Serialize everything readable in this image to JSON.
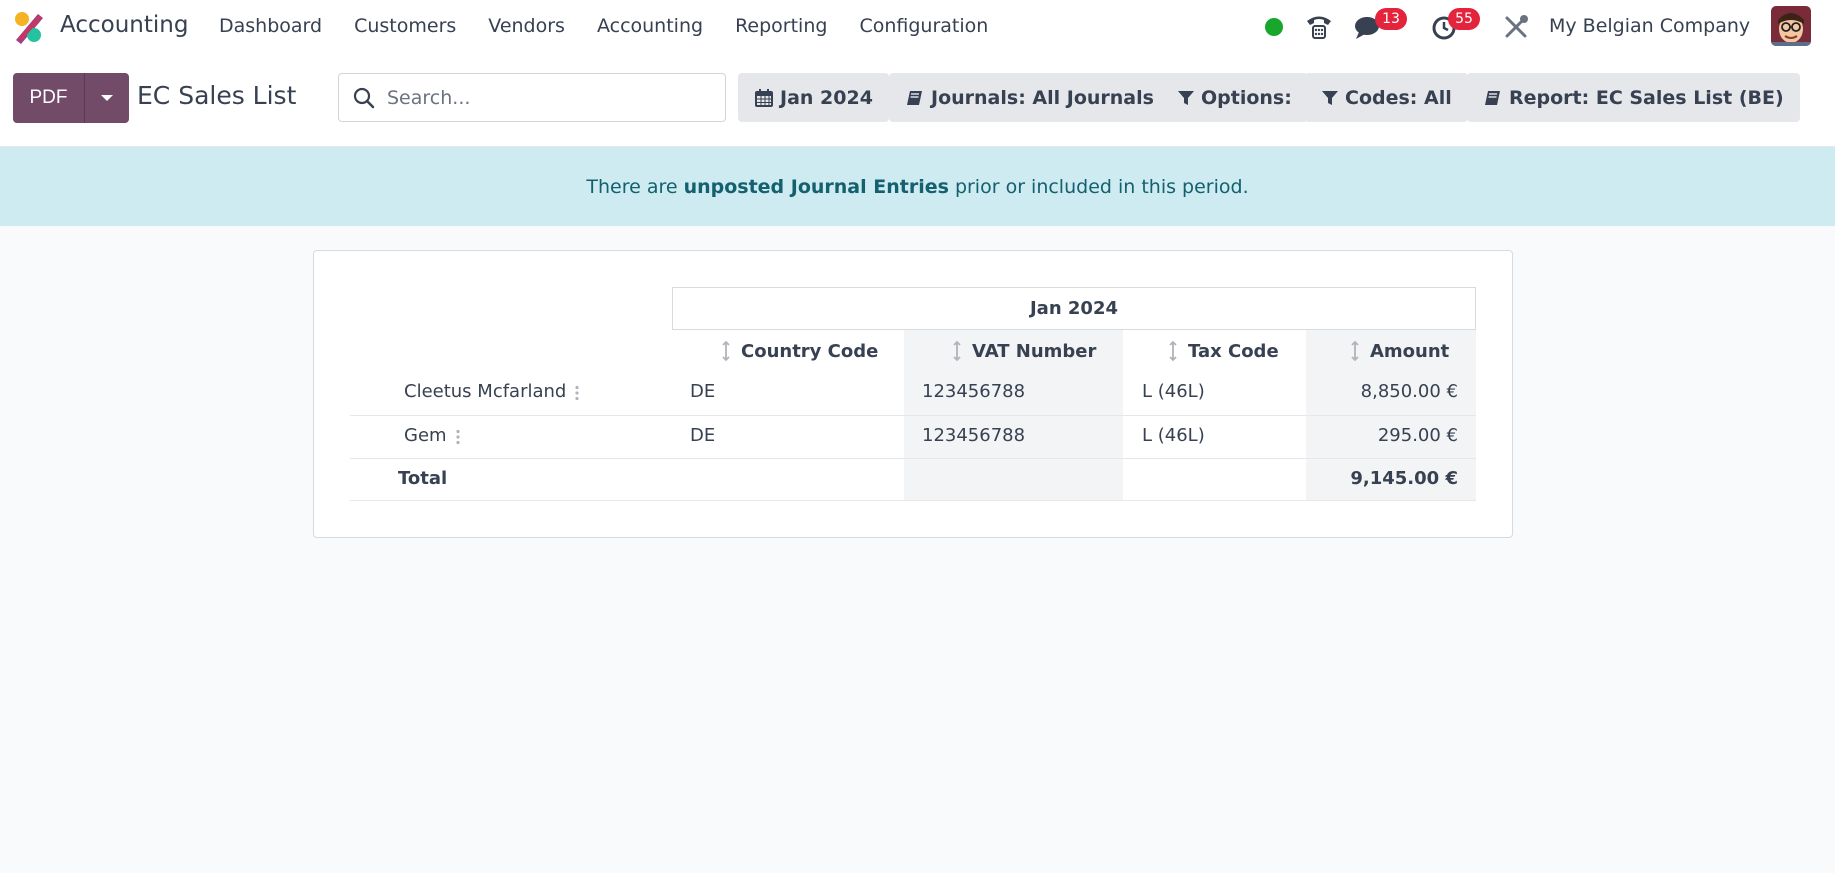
{
  "navbar": {
    "app_name": "Accounting",
    "menu": [
      "Dashboard",
      "Customers",
      "Vendors",
      "Accounting",
      "Reporting",
      "Configuration"
    ],
    "messages_badge": "13",
    "activities_badge": "55",
    "company": "My Belgian Company",
    "status_color": "#18a62b"
  },
  "control_panel": {
    "pdf_label": "PDF",
    "title": "EC Sales List",
    "search_placeholder": "Search...",
    "filters": {
      "date": "Jan 2024",
      "journals": "Journals: All Journals",
      "options": "Options:",
      "codes": "Codes: All",
      "report": "Report: EC Sales List (BE)"
    }
  },
  "alert": {
    "before": "There are",
    "link": "unposted Journal Entries",
    "after": "prior or included in this period."
  },
  "report": {
    "period": "Jan 2024",
    "columns": [
      "Country Code",
      "VAT Number",
      "Tax Code",
      "Amount"
    ],
    "rows": [
      {
        "name": "Cleetus Mcfarland",
        "country": "DE",
        "vat": "123456788",
        "tax_code": "L (46L)",
        "amount": "8,850.00 €"
      },
      {
        "name": "Gem",
        "country": "DE",
        "vat": "123456788",
        "tax_code": "L (46L)",
        "amount": "295.00 €"
      }
    ],
    "total": {
      "label": "Total",
      "amount": "9,145.00 €"
    }
  }
}
